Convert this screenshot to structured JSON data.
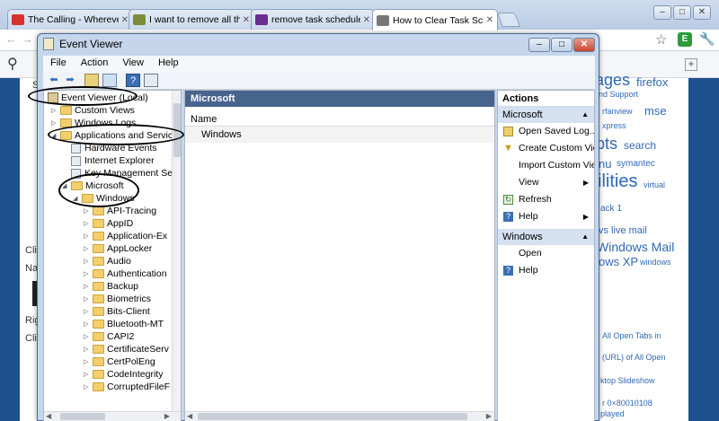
{
  "browser": {
    "tabs": [
      {
        "label": "The Calling - Wherever",
        "color": "#d8312c"
      },
      {
        "label": "I want to remove all the",
        "color": "#7e8c3a"
      },
      {
        "label": "remove task scheduler",
        "color": "#6b2c91"
      },
      {
        "label": "How to Clear Task Sche",
        "color": "#777777"
      }
    ],
    "win_min": "–",
    "win_max": "□",
    "win_close": "✕",
    "back_icon": "←",
    "forward_icon": "→",
    "star_icon": "☆",
    "wrench_icon": "🔧",
    "search_icon": "⚲",
    "plus_icon": "+"
  },
  "page": {
    "left_fragments": [
      "S",
      "Cli",
      "Na",
      "Rig",
      "Cli"
    ],
    "cloud": [
      {
        "text": "ages",
        "size": 18
      },
      {
        "text": "firefox",
        "size": 13
      },
      {
        "text": "nd Support",
        "size": 9
      },
      {
        "text": "rfanview",
        "size": 9
      },
      {
        "text": "mse",
        "size": 13
      },
      {
        "text": "xpress",
        "size": 9
      },
      {
        "text": "pts",
        "size": 18
      },
      {
        "text": "search",
        "size": 12
      },
      {
        "text": "nu",
        "size": 13
      },
      {
        "text": "symantec",
        "size": 10
      },
      {
        "text": "ilities",
        "size": 20
      },
      {
        "text": "virtual",
        "size": 9
      },
      {
        "text": "ack 1",
        "size": 10
      },
      {
        "text": "vs live mail",
        "size": 11
      },
      {
        "text": "Windows Mail",
        "size": 14
      },
      {
        "text": "ows XP",
        "size": 13
      },
      {
        "text": "windows",
        "size": 9
      },
      {
        "text": "All Open Tabs in",
        "size": 9
      },
      {
        "text": "(URL) of All Open",
        "size": 9
      },
      {
        "text": "ktop Slideshow",
        "size": 9
      },
      {
        "text": "r 0×80010108",
        "size": 9
      },
      {
        "text": "played",
        "size": 9
      }
    ]
  },
  "event_viewer": {
    "title": "Event Viewer",
    "menu": [
      "File",
      "Action",
      "View",
      "Help"
    ],
    "tree": [
      {
        "label": "Event Viewer (Local)",
        "indent": 0,
        "icon": "event-viewer",
        "toggle": ""
      },
      {
        "label": "Custom Views",
        "indent": 1,
        "icon": "folder",
        "toggle": "▷"
      },
      {
        "label": "Windows Logs",
        "indent": 1,
        "icon": "folder",
        "toggle": "▷"
      },
      {
        "label": "Applications and Services",
        "indent": 1,
        "icon": "folder",
        "toggle": "◢"
      },
      {
        "label": "Hardware Events",
        "indent": 2,
        "icon": "log",
        "toggle": ""
      },
      {
        "label": "Internet Explorer",
        "indent": 2,
        "icon": "log",
        "toggle": ""
      },
      {
        "label": "Key Management Serv",
        "indent": 2,
        "icon": "log",
        "toggle": ""
      },
      {
        "label": "Microsoft",
        "indent": 2,
        "icon": "folder",
        "toggle": "◢"
      },
      {
        "label": "Windows",
        "indent": 3,
        "icon": "folder",
        "toggle": "◢"
      },
      {
        "label": "API-Tracing",
        "indent": 4,
        "icon": "folder",
        "toggle": "▷"
      },
      {
        "label": "AppID",
        "indent": 4,
        "icon": "folder",
        "toggle": "▷"
      },
      {
        "label": "Application-Ex",
        "indent": 4,
        "icon": "folder",
        "toggle": "▷"
      },
      {
        "label": "AppLocker",
        "indent": 4,
        "icon": "folder",
        "toggle": "▷"
      },
      {
        "label": "Audio",
        "indent": 4,
        "icon": "folder",
        "toggle": "▷"
      },
      {
        "label": "Authentication",
        "indent": 4,
        "icon": "folder",
        "toggle": "▷"
      },
      {
        "label": "Backup",
        "indent": 4,
        "icon": "folder",
        "toggle": "▷"
      },
      {
        "label": "Biometrics",
        "indent": 4,
        "icon": "folder",
        "toggle": "▷"
      },
      {
        "label": "Bits-Client",
        "indent": 4,
        "icon": "folder",
        "toggle": "▷"
      },
      {
        "label": "Bluetooth-MT",
        "indent": 4,
        "icon": "folder",
        "toggle": "▷"
      },
      {
        "label": "CAPI2",
        "indent": 4,
        "icon": "folder",
        "toggle": "▷"
      },
      {
        "label": "CertificateServ",
        "indent": 4,
        "icon": "folder",
        "toggle": "▷"
      },
      {
        "label": "CertPolEng",
        "indent": 4,
        "icon": "folder",
        "toggle": "▷"
      },
      {
        "label": "CodeIntegrity",
        "indent": 4,
        "icon": "folder",
        "toggle": "▷"
      },
      {
        "label": "CorruptedFileF",
        "indent": 4,
        "icon": "folder",
        "toggle": "▷"
      }
    ],
    "center": {
      "header": "Microsoft",
      "column": "Name",
      "rows": [
        "Windows"
      ]
    },
    "actions": {
      "title": "Actions",
      "sections": [
        {
          "name": "Microsoft",
          "items": [
            {
              "label": "Open Saved Log...",
              "icon": "open-log",
              "submenu": false
            },
            {
              "label": "Create Custom View...",
              "icon": "filter",
              "submenu": false
            },
            {
              "label": "Import Custom View...",
              "icon": "",
              "submenu": false
            },
            {
              "label": "View",
              "icon": "",
              "submenu": true
            },
            {
              "label": "Refresh",
              "icon": "refresh",
              "submenu": false
            },
            {
              "label": "Help",
              "icon": "help",
              "submenu": true
            }
          ]
        },
        {
          "name": "Windows",
          "items": [
            {
              "label": "Open",
              "icon": "",
              "submenu": false
            },
            {
              "label": "Help",
              "icon": "help",
              "submenu": false
            }
          ]
        }
      ]
    }
  }
}
